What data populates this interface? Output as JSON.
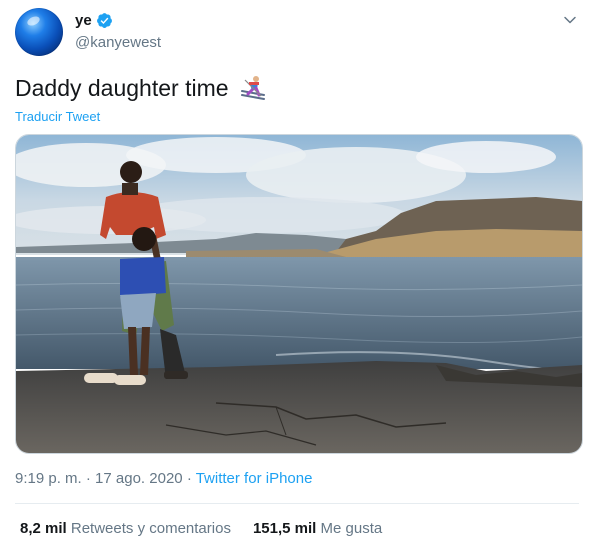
{
  "author": {
    "display_name": "ye",
    "handle": "@kanyewest",
    "verified": true
  },
  "tweet": {
    "text": "Daddy daughter time",
    "emoji": "skier-emoji",
    "translate_label": "Traducir Tweet",
    "time": "9:19 p. m.",
    "separator": "·",
    "date": "17 ago. 2020",
    "source": "Twitter for iPhone"
  },
  "stats": {
    "retweets_count": "8,2 mil",
    "retweets_label": "Retweets y comentarios",
    "likes_count": "151,5 mil",
    "likes_label": "Me gusta"
  },
  "colors": {
    "accent": "#1da1f2",
    "secondary_text": "#657786",
    "primary_text": "#14171a"
  },
  "photo": {
    "description_icon": "photo-image"
  }
}
